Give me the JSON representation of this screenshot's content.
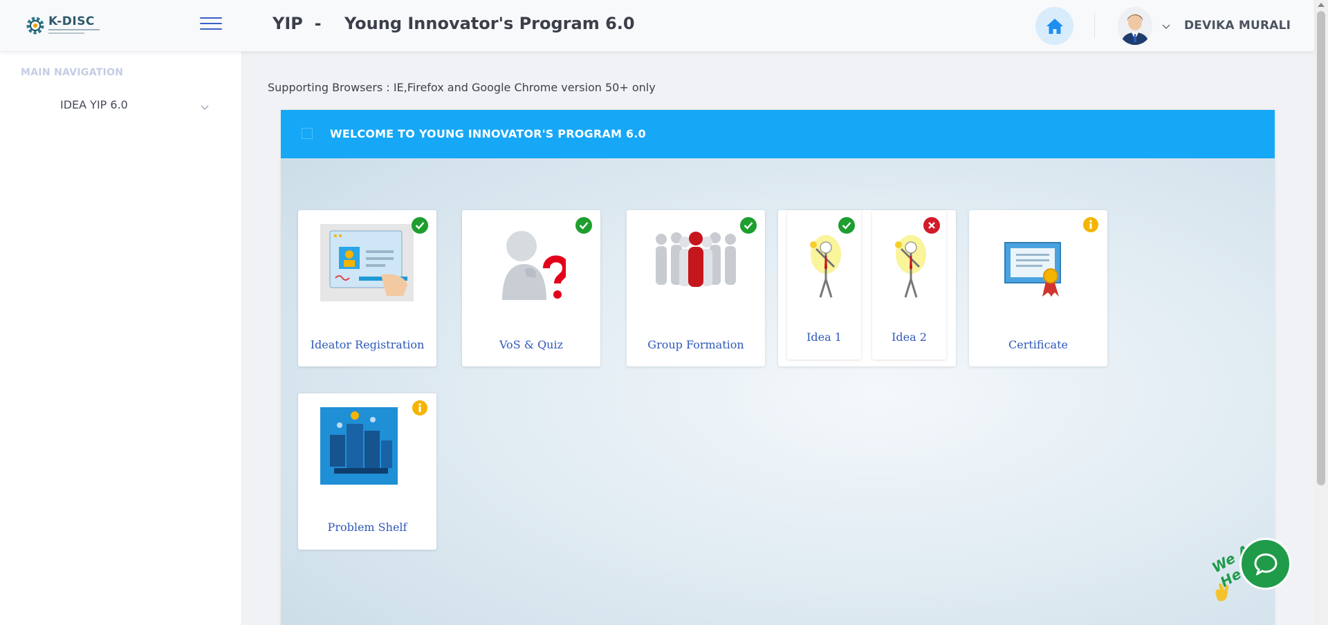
{
  "header": {
    "logo_text": "K-DISC",
    "title": "YIP  -    Young Innovator's Program 6.0",
    "home_icon": "home-icon",
    "user_name": "DEVIKA MURALI"
  },
  "sidebar": {
    "heading": "MAIN NAVIGATION",
    "items": [
      {
        "label": "IDEA YIP 6.0"
      }
    ]
  },
  "main": {
    "support_note": "Supporting Browsers : IE,Firefox and Google Chrome version 50+ only",
    "panel_title": "WELCOME TO YOUNG INNOVATOR'S PROGRAM 6.0",
    "cards": [
      {
        "label": "Ideator Registration",
        "status": "completed"
      },
      {
        "label": "VoS & Quiz",
        "status": "completed"
      },
      {
        "label": "Group Formation",
        "status": "completed"
      },
      {
        "label": "Idea 1",
        "status": "completed"
      },
      {
        "label": "Idea 2",
        "status": "not-completed"
      },
      {
        "label": "Certificate",
        "status": "info"
      },
      {
        "label": "Problem Shelf",
        "status": "info"
      }
    ]
  },
  "chat": {
    "tag": "We Are Here!"
  },
  "colors": {
    "accent": "#16a7f7",
    "success": "#1e9e2f",
    "error": "#d11a2a",
    "info": "#f4b400",
    "link": "#2e58b8"
  }
}
